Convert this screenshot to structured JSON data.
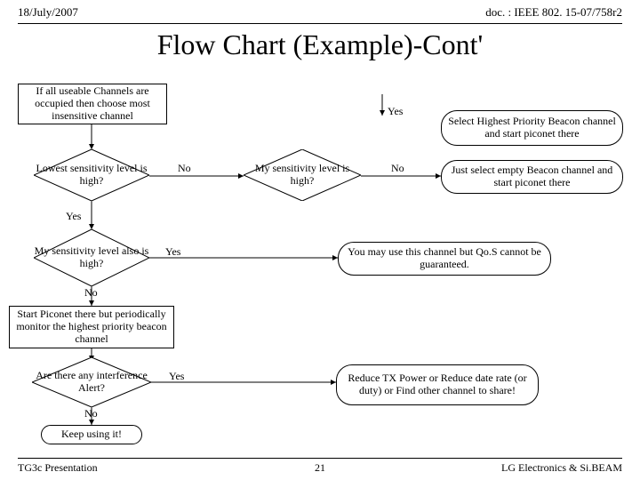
{
  "header": {
    "date": "18/July/2007",
    "doc": "doc. : IEEE 802. 15-07/758r2"
  },
  "title": "Flow Chart (Example)-Cont'",
  "footer": {
    "left": "TG3c Presentation",
    "center": "21",
    "right": "LG Electronics & Si.BEAM"
  },
  "nodes": {
    "ifAll": "If all useable Channels are occupied then choose most insensitive channel",
    "lowest": "Lowest sensitivity level is high?",
    "mySens": "My sensitivity level is high?",
    "selHigh": "Select Highest Priority Beacon channel and start piconet there",
    "selEmpty": "Just select empty Beacon channel and start piconet there",
    "myAlso": "My sensitivity level also is high?",
    "mayUse": "You may use this channel but Qo.S cannot be guaranteed.",
    "startPic": "Start Piconet there but periodically monitor the highest priority beacon channel",
    "interfere": "Are there any interference Alert?",
    "reduce": "Reduce TX Power or Reduce date rate (or duty) or Find other channel to share!",
    "keep": "Keep using it!"
  },
  "labels": {
    "yes": "Yes",
    "no": "No"
  }
}
